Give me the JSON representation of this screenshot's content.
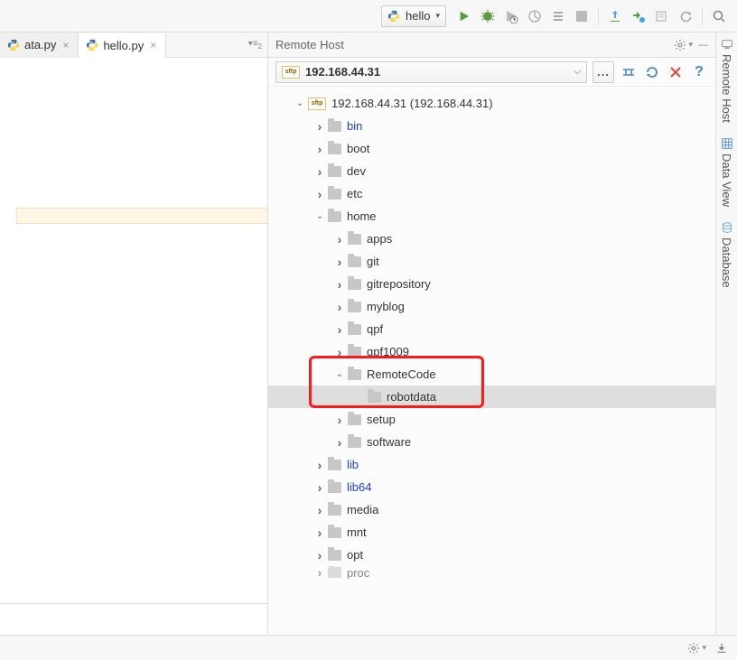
{
  "toolbar": {
    "run_config": "hello"
  },
  "editor": {
    "tabs": [
      {
        "label": "ata.py",
        "active": false
      },
      {
        "label": "hello.py",
        "active": true
      }
    ]
  },
  "remote_host": {
    "title": "Remote Host",
    "connection": {
      "badge": "sftp",
      "label": "192.168.44.31"
    },
    "root_label": "192.168.44.31 (192.168.44.31)",
    "tree": [
      {
        "depth": 1,
        "arrow": "down",
        "icon": "sftp",
        "label": "192.168.44.31 (192.168.44.31)",
        "key": "root"
      },
      {
        "depth": 2,
        "arrow": "right",
        "icon": "folder",
        "label": "bin",
        "link": true
      },
      {
        "depth": 2,
        "arrow": "right",
        "icon": "folder",
        "label": "boot"
      },
      {
        "depth": 2,
        "arrow": "right",
        "icon": "folder",
        "label": "dev"
      },
      {
        "depth": 2,
        "arrow": "right",
        "icon": "folder",
        "label": "etc"
      },
      {
        "depth": 2,
        "arrow": "down",
        "icon": "folder",
        "label": "home"
      },
      {
        "depth": 3,
        "arrow": "right",
        "icon": "folder",
        "label": "apps"
      },
      {
        "depth": 3,
        "arrow": "right",
        "icon": "folder",
        "label": "git"
      },
      {
        "depth": 3,
        "arrow": "right",
        "icon": "folder",
        "label": "gitrepository"
      },
      {
        "depth": 3,
        "arrow": "right",
        "icon": "folder",
        "label": "myblog"
      },
      {
        "depth": 3,
        "arrow": "right",
        "icon": "folder",
        "label": "qpf"
      },
      {
        "depth": 3,
        "arrow": "right",
        "icon": "folder",
        "label": "qpf1009"
      },
      {
        "depth": 3,
        "arrow": "down",
        "icon": "folder",
        "label": "RemoteCode"
      },
      {
        "depth": 4,
        "arrow": "none",
        "icon": "folder",
        "label": "robotdata",
        "selected": true
      },
      {
        "depth": 3,
        "arrow": "right",
        "icon": "folder",
        "label": "setup"
      },
      {
        "depth": 3,
        "arrow": "right",
        "icon": "folder",
        "label": "software"
      },
      {
        "depth": 2,
        "arrow": "right",
        "icon": "folder",
        "label": "lib",
        "link": true
      },
      {
        "depth": 2,
        "arrow": "right",
        "icon": "folder",
        "label": "lib64",
        "link": true
      },
      {
        "depth": 2,
        "arrow": "right",
        "icon": "folder",
        "label": "media"
      },
      {
        "depth": 2,
        "arrow": "right",
        "icon": "folder",
        "label": "mnt"
      },
      {
        "depth": 2,
        "arrow": "right",
        "icon": "folder",
        "label": "opt"
      },
      {
        "depth": 2,
        "arrow": "right",
        "icon": "folder",
        "label": "proc",
        "cut": true
      }
    ]
  },
  "side_rail": {
    "items": [
      {
        "label": "Remote Host"
      },
      {
        "label": "Data View"
      },
      {
        "label": "Database"
      }
    ]
  }
}
